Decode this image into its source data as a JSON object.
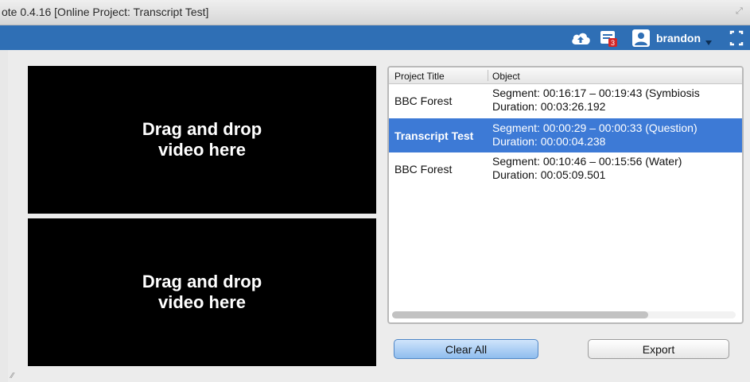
{
  "window": {
    "title": "ote 0.4.16 [Online Project: Transcript Test]"
  },
  "toolbar": {
    "icons": [
      "upload-cloud-icon",
      "notifications-icon",
      "user-icon",
      "fullscreen-icon"
    ],
    "notification_count": "3",
    "username": "brandon",
    "accent_color": "#2f6fb5"
  },
  "video_slots": [
    {
      "label_line1": "Drag and drop",
      "label_line2": "video here"
    },
    {
      "label_line1": "Drag and drop",
      "label_line2": "video here"
    }
  ],
  "segments_table": {
    "columns": [
      "Project Title",
      "Object"
    ],
    "rows": [
      {
        "project": "BBC Forest",
        "segment": "Segment: 00:16:17 – 00:19:43 (Symbiosis",
        "duration": "Duration: 00:03:26.192",
        "selected": false
      },
      {
        "project": "Transcript Test",
        "segment": "Segment: 00:00:29 – 00:00:33 (Question)",
        "duration": "Duration: 00:00:04.238",
        "selected": true
      },
      {
        "project": "BBC Forest",
        "segment": "Segment: 00:10:46 – 00:15:56 (Water)",
        "duration": "Duration: 00:05:09.501",
        "selected": false
      }
    ],
    "selected_color": "#3d7ad6"
  },
  "buttons": {
    "clear_all": "Clear All",
    "export": "Export"
  }
}
